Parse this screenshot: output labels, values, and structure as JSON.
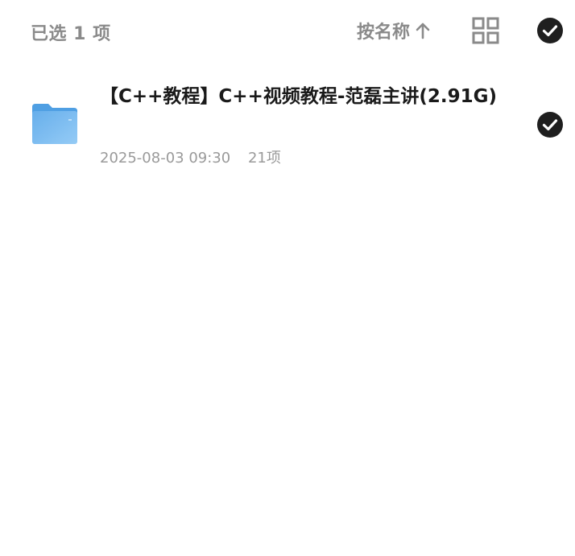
{
  "header": {
    "selected_label": "已选 1 项",
    "sort_label": "按名称",
    "sort_icon": "arrow-up-icon",
    "view_icon": "grid-view-icon",
    "select_all_icon": "check-circle-icon"
  },
  "files": [
    {
      "name": "【C++教程】C++视频教程-范磊主讲(2.91G)",
      "date": "2025-08-03 09:30",
      "count": "21项",
      "icon": "folder-icon",
      "selected": true
    }
  ],
  "colors": {
    "muted": "#8a8a8a",
    "text": "#1a1a1a",
    "check_bg": "#1f1f1f",
    "folder_blue": "#6db4ef"
  }
}
